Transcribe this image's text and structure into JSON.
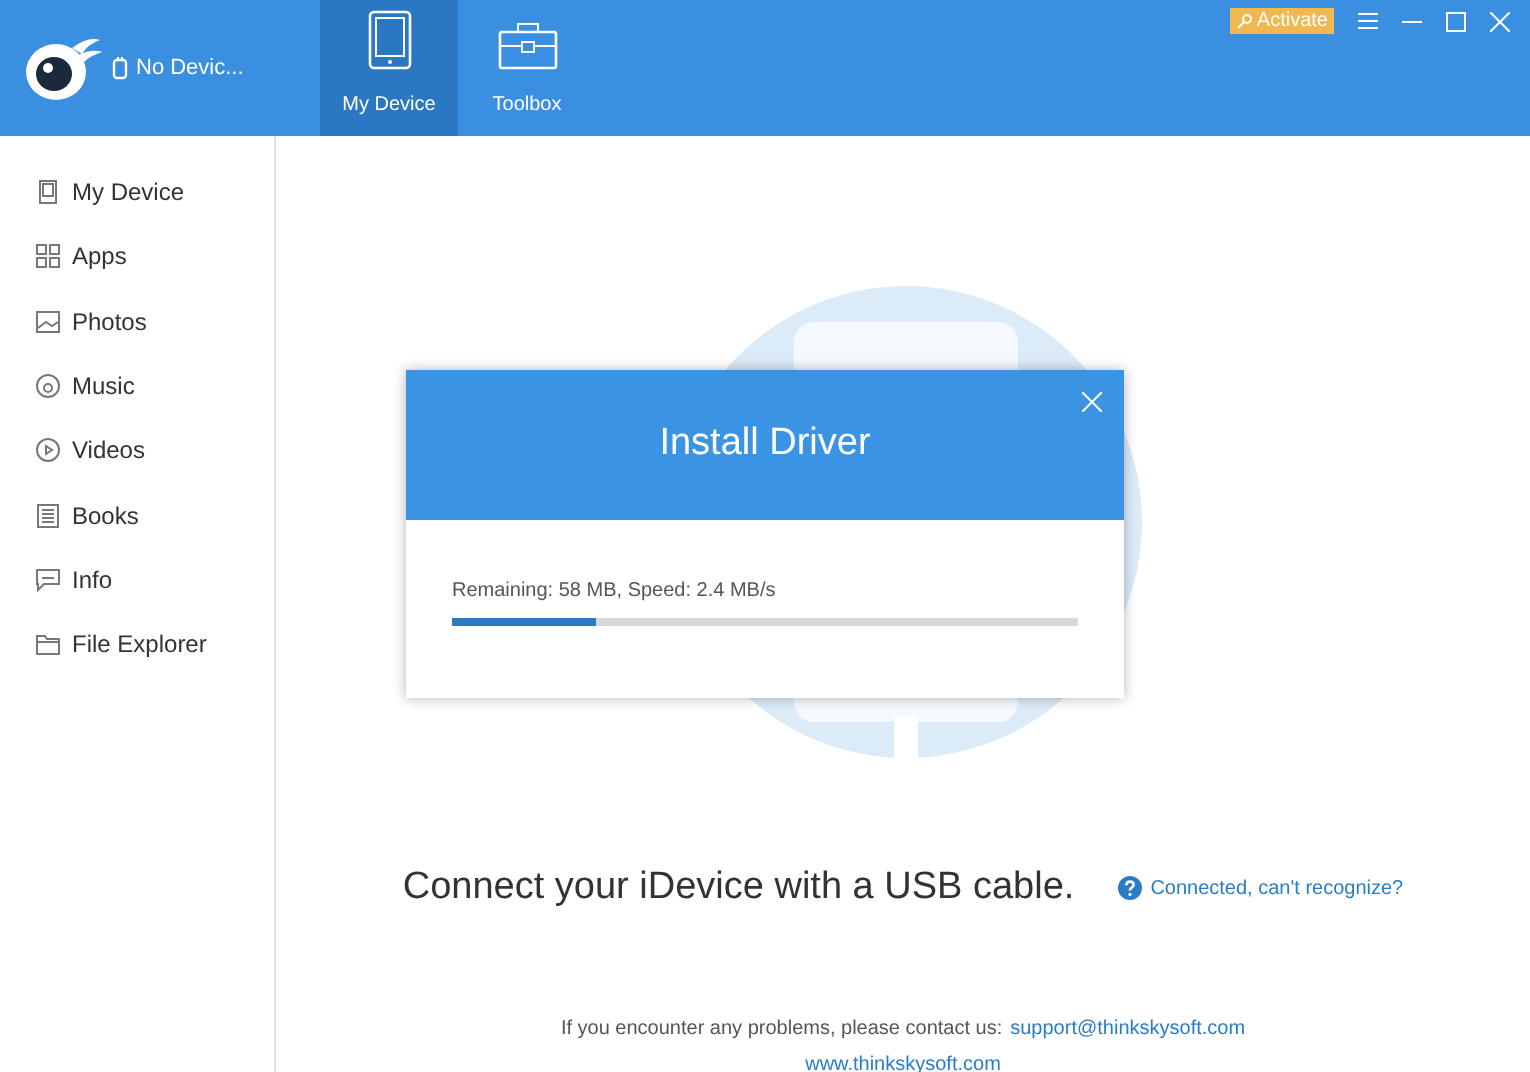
{
  "header": {
    "device": "No Devic...",
    "tabs": [
      {
        "label": "My Device",
        "selected": true
      },
      {
        "label": "Toolbox",
        "selected": false
      }
    ],
    "activate": "Activate"
  },
  "sidebar": {
    "items": [
      {
        "label": "My Device"
      },
      {
        "label": "Apps"
      },
      {
        "label": "Photos"
      },
      {
        "label": "Music"
      },
      {
        "label": "Videos"
      },
      {
        "label": "Books"
      },
      {
        "label": "Info"
      },
      {
        "label": "File Explorer"
      }
    ]
  },
  "dialog": {
    "title": "Install Driver",
    "status": "Remaining: 58 MB, Speed: 2.4 MB/s",
    "level": 0.23
  },
  "main": {
    "message": "Connect your iDevice with a USB cable.",
    "help_link": "Connected, can't recognize?",
    "contact": "If you encounter any problems, please contact us:",
    "email": "support@thinkskysoft.com",
    "website": "www.thinkskysoft.com"
  }
}
